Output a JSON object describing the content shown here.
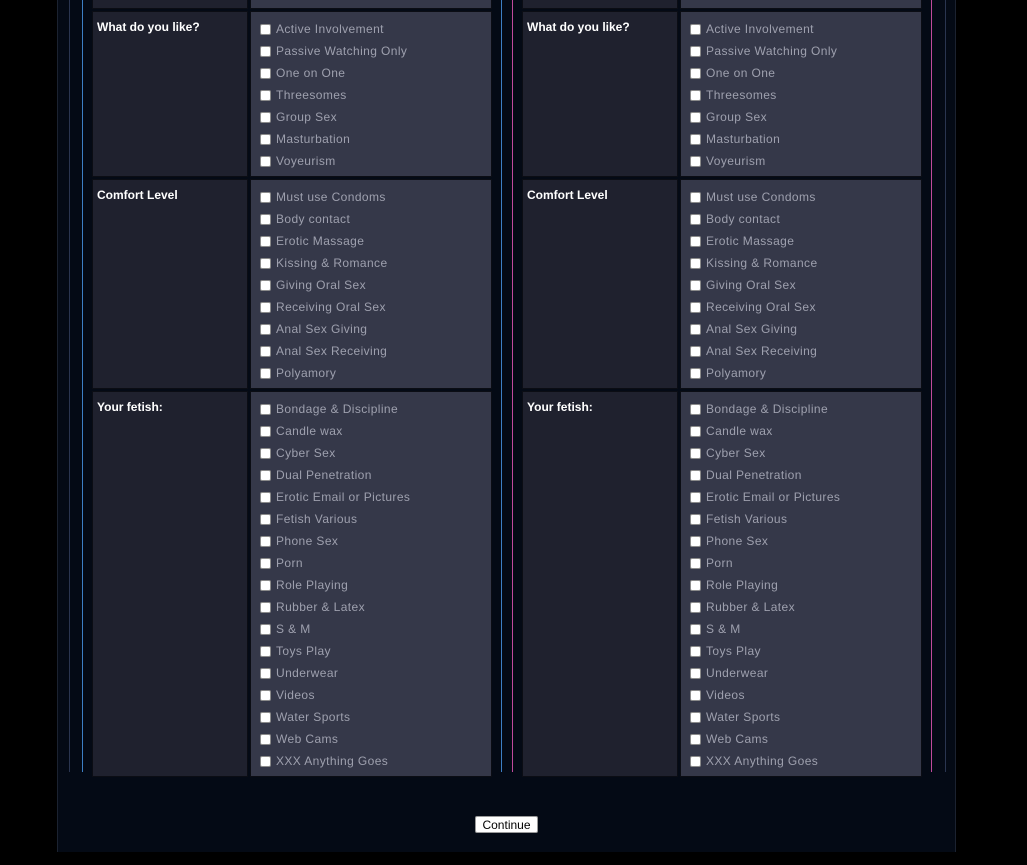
{
  "sections": [
    {
      "title": "What do you like?",
      "options": [
        "Active Involvement",
        "Passive Watching Only",
        "One on One",
        "Threesomes",
        "Group Sex",
        "Masturbation",
        "Voyeurism"
      ]
    },
    {
      "title": "Comfort Level",
      "options": [
        "Must use Condoms",
        "Body contact",
        "Erotic Massage",
        "Kissing & Romance",
        "Giving Oral Sex",
        "Receiving Oral Sex",
        "Anal Sex Giving",
        "Anal Sex Receiving",
        "Polyamory"
      ]
    },
    {
      "title": "Your fetish:",
      "options": [
        "Bondage & Discipline",
        "Candle wax",
        "Cyber Sex",
        "Dual Penetration",
        "Erotic Email or Pictures",
        "Fetish Various",
        "Phone Sex",
        "Porn",
        "Role Playing",
        "Rubber & Latex",
        "S & M",
        "Toys Play",
        "Underwear",
        "Videos",
        "Water Sports",
        "Web Cams",
        "XXX Anything Goes"
      ]
    }
  ],
  "continue_label": "Continue",
  "colors": {
    "left_accent": "#3d7fc4",
    "right_accent": "#c04a9c"
  }
}
